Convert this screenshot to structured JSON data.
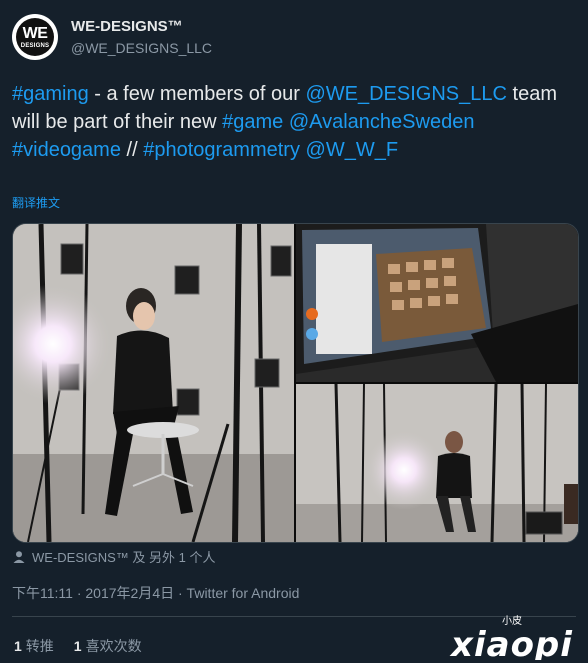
{
  "author": {
    "display_name": "WE-DESIGNS™",
    "handle": "@WE_DESIGNS_LLC",
    "avatar_text": "WE",
    "avatar_subtext": "DESIGNS"
  },
  "tweet": {
    "segments": [
      {
        "text": "#gaming",
        "link": true
      },
      {
        "text": " - a few members of our ",
        "link": false
      },
      {
        "text": "@WE_DESIGNS_LLC",
        "link": true
      },
      {
        "text": " team will be part of their new ",
        "link": false
      },
      {
        "text": "#game",
        "link": true
      },
      {
        "text": " ",
        "link": false
      },
      {
        "text": "@AvalancheSweden",
        "link": true
      },
      {
        "text": " ",
        "link": false
      },
      {
        "text": "#videogame",
        "link": true
      },
      {
        "text": " // ",
        "link": false
      },
      {
        "text": "#photogrammetry",
        "link": true
      },
      {
        "text": " ",
        "link": false
      },
      {
        "text": "@W_W_F",
        "link": true
      }
    ],
    "translate_label": "翻译推文"
  },
  "media": {
    "photos": [
      "photogrammetry-rig-photo",
      "laptop-software-photo",
      "studio-subject-photo"
    ]
  },
  "liked_by": "WE-DESIGNS™ 及 另外 1 个人",
  "meta": "下午11:11 · 2017年2月4日 · Twitter for Android",
  "stats": {
    "retweets_count": "1",
    "retweets_label": "转推",
    "likes_count": "1",
    "likes_label": "喜欢次数"
  },
  "watermark": {
    "small_text": "小皮",
    "text": "xiaopi"
  },
  "colors": {
    "background": "#15202b",
    "link": "#1d9bf0",
    "text": "#e7e9ea",
    "muted": "#8b98a5",
    "border": "#38444d"
  }
}
